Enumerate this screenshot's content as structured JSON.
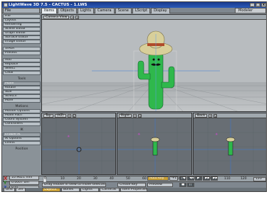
{
  "window": {
    "title": "LightWave 3D 7.5 - CACTUS - 1.LWS",
    "buttons": [
      "_",
      "□",
      "x"
    ]
  },
  "tabs": {
    "items": [
      "Items",
      "Objects",
      "Lights",
      "Camera",
      "Scene",
      "LScript",
      "Display"
    ],
    "active": 0,
    "left_header": "File",
    "modeler_label": "Modeler"
  },
  "sidebar": {
    "items": [
      "File",
      "Layout",
      "Rendering",
      "Scene Editor",
      "Graph Editor",
      "Surface Editor",
      "Image Editor",
      "VIPER",
      "Presets",
      "Add",
      "Replace",
      "Select",
      "Clear"
    ],
    "tools_label": "Tools",
    "tools": [
      "Move",
      "Rotate",
      "Size",
      "Stretch",
      "More"
    ],
    "motions_label": "Motions",
    "motions": [
      "Motion Options",
      "Move Path",
      "Coord System",
      "Controllers"
    ],
    "ik_label": "IK",
    "ik": [
      "Enable IK",
      "IK Options",
      "Limits"
    ],
    "position_label": "Position"
  },
  "viewports": {
    "main_view_label": "Camera View",
    "top_label": "Top",
    "right_label": "Right",
    "back_label": "Back",
    "view_mode": "(XZ)"
  },
  "timeline": {
    "ticks": [
      "0",
      "10",
      "20",
      "30",
      "40",
      "50",
      "60",
      "70",
      "80",
      "90",
      "100",
      "110",
      "120"
    ],
    "end_frame": "120"
  },
  "bottom": {
    "x_value": "10.9621 mm",
    "y_value": "0.0007 um",
    "z_value": "0 m",
    "grid_label": "Grid",
    "grid_value": "5m",
    "hint": "Drag mouse in view to move selected items.",
    "set_label": "Set",
    "current_item_label": "Current Item",
    "current_item": "cactus_dancingCactus",
    "create_key": "Create Key",
    "delete_key": "Delete Key",
    "auto_key": "Auto Key",
    "auto_key_value": "-F1",
    "preview": "Preview",
    "objects": "Objects",
    "bones": "Bones",
    "lights": "Lights",
    "cameras": "Cameras",
    "item_properties": "Item Properties",
    "step_label": "Step",
    "step_value": "1"
  },
  "colors": {
    "accent": "#c8a038",
    "cactus": "#2fb84c",
    "hat": "#d8cf9a",
    "title_bar": "#1e4aa0"
  }
}
